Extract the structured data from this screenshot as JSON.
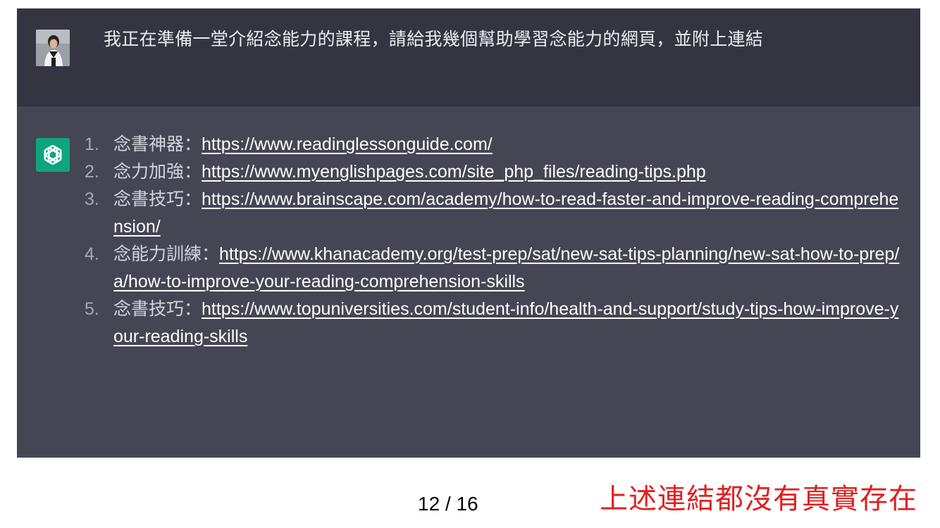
{
  "user_message": {
    "avatar_icon": "user-photo-avatar",
    "text": "我正在準備一堂介紹念能力的課程，請給我幾個幫助學習念能力的網頁，並附上連結"
  },
  "assistant_message": {
    "avatar_icon": "openai-logo-icon",
    "accent_color": "#10a37f",
    "items": [
      {
        "number": "1.",
        "label": "念書神器：",
        "url": "https://www.readinglessonguide.com/"
      },
      {
        "number": "2.",
        "label": "念力加強：",
        "url": "https://www.myenglishpages.com/site_php_files/reading-tips.php"
      },
      {
        "number": "3.",
        "label": "念書技巧：",
        "url": "https://www.brainscape.com/academy/how-to-read-faster-and-improve-reading-comprehension/"
      },
      {
        "number": "4.",
        "label": "念能力訓練：",
        "url": "https://www.khanacademy.org/test-prep/sat/new-sat-tips-planning/new-sat-how-to-prep/a/how-to-improve-your-reading-comprehension-skills"
      },
      {
        "number": "5.",
        "label": "念書技巧：",
        "url": "https://www.topuniversities.com/student-info/health-and-support/study-tips-how-improve-your-reading-skills"
      }
    ]
  },
  "footer": {
    "page_indicator": "12 / 16",
    "annotation": "上述連結都沒有真實存在",
    "annotation_color": "#e02020"
  }
}
